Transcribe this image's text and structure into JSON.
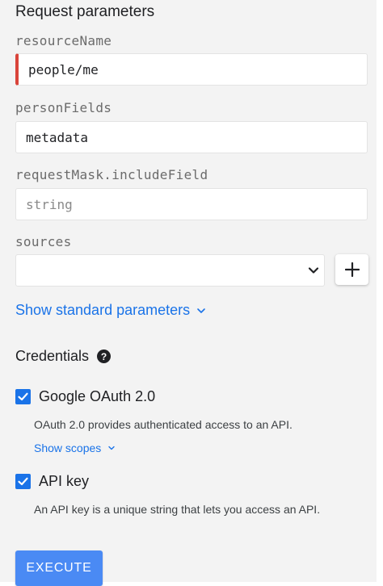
{
  "request_parameters": {
    "title": "Request parameters",
    "fields": [
      {
        "label": "resourceName",
        "value": "people/me"
      },
      {
        "label": "personFields",
        "value": "metadata"
      },
      {
        "label": "requestMask.includeField",
        "placeholder": "string"
      },
      {
        "label": "sources",
        "value": ""
      }
    ],
    "show_standard_parameters": "Show standard parameters"
  },
  "credentials": {
    "title": "Credentials",
    "help_icon": "help-circle-icon",
    "options": [
      {
        "label": "Google OAuth 2.0",
        "checked": true,
        "description": "OAuth 2.0 provides authenticated access to an API.",
        "show_scopes": "Show scopes"
      },
      {
        "label": "API key",
        "checked": true,
        "description": "An API key is a unique string that lets you access an API."
      }
    ]
  },
  "execute_label": "EXECUTE",
  "colors": {
    "accent": "#1a73e8",
    "error": "#d9443a",
    "button": "#4a8af4",
    "panel_bg": "#f3f3f3"
  }
}
